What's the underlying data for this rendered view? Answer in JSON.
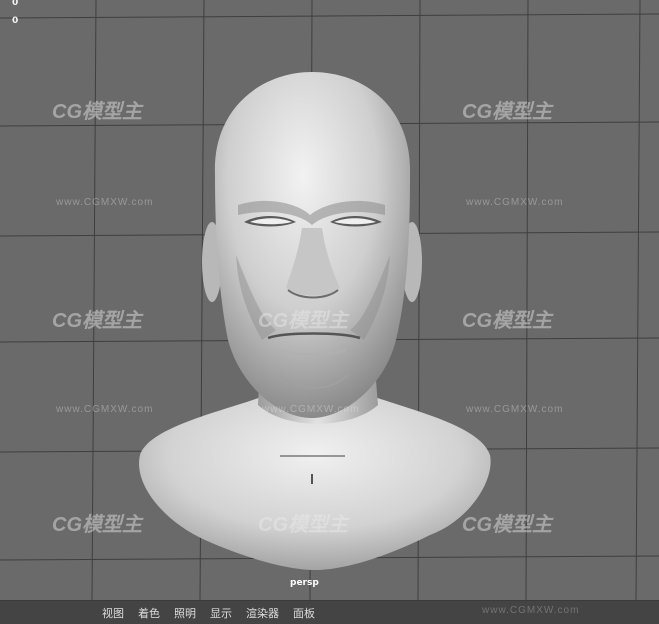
{
  "hud": {
    "value_top": "0",
    "value_second": "0"
  },
  "viewport": {
    "camera_name": "persp"
  },
  "watermark": {
    "logo_text": "CG模型主",
    "url_text": "www.CGMXW.com"
  },
  "menubar": {
    "items": [
      "视图",
      "着色",
      "照明",
      "显示",
      "渲染器",
      "面板"
    ]
  },
  "colors": {
    "background": "#6a6a6a",
    "grid": "#3c3c3c",
    "menubar_bg": "#444444",
    "model": "#d9d9d9"
  }
}
